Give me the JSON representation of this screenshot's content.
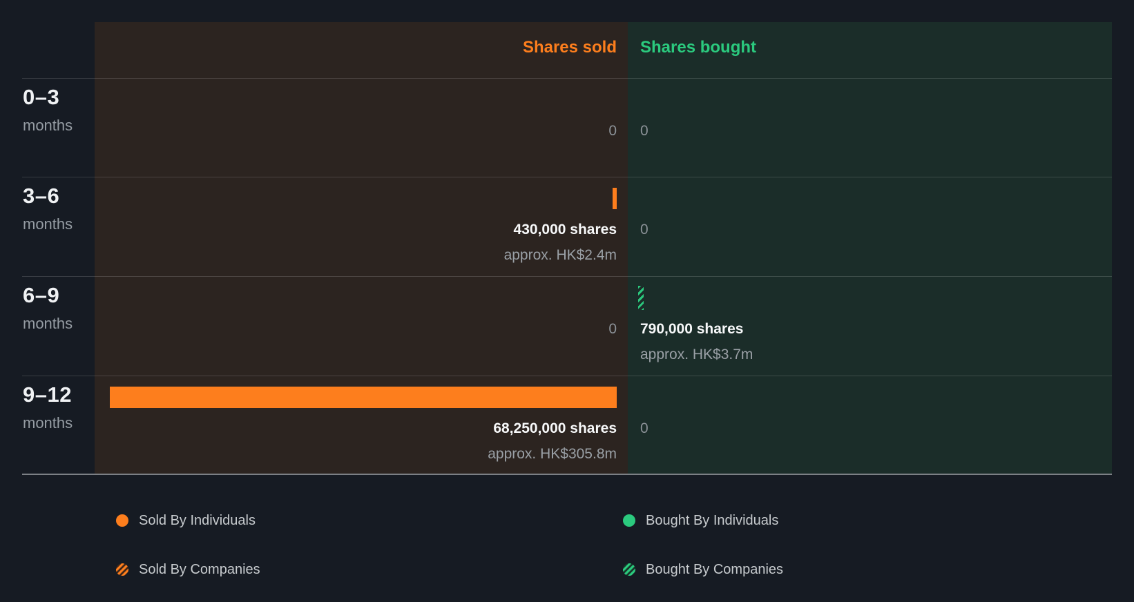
{
  "chart_data": {
    "type": "bar",
    "orientation": "horizontal",
    "unit": "shares",
    "currency": "HK$",
    "xmax": 68250000,
    "grid": "horizontal-row-dividers",
    "columns": [
      {
        "key": "sold",
        "header": "Shares sold",
        "color": "#fd7e1d"
      },
      {
        "key": "bought",
        "header": "Shares bought",
        "color": "#2bca7e"
      }
    ],
    "categories": [
      "0–3 months",
      "3–6 months",
      "6–9 months",
      "9–12 months"
    ],
    "series": [
      {
        "name": "Shares sold",
        "values": [
          0,
          430000,
          0,
          68250000
        ]
      },
      {
        "name": "Shares bought",
        "values": [
          0,
          0,
          790000,
          0
        ]
      }
    ],
    "rows": [
      {
        "period": "0–3",
        "period_unit": "months",
        "sold": {
          "value": 0,
          "label": "0",
          "approx": "",
          "hatched": false
        },
        "bought": {
          "value": 0,
          "label": "0",
          "approx": "",
          "hatched": false
        }
      },
      {
        "period": "3–6",
        "period_unit": "months",
        "sold": {
          "value": 430000,
          "label": "430,000 shares",
          "approx": "approx. HK$2.4m",
          "hatched": false
        },
        "bought": {
          "value": 0,
          "label": "0",
          "approx": "",
          "hatched": false
        }
      },
      {
        "period": "6–9",
        "period_unit": "months",
        "sold": {
          "value": 0,
          "label": "0",
          "approx": "",
          "hatched": false
        },
        "bought": {
          "value": 790000,
          "label": "790,000 shares",
          "approx": "approx. HK$3.7m",
          "hatched": true
        }
      },
      {
        "period": "9–12",
        "period_unit": "months",
        "sold": {
          "value": 68250000,
          "label": "68,250,000 shares",
          "approx": "approx. HK$305.8m",
          "hatched": false
        },
        "bought": {
          "value": 0,
          "label": "0",
          "approx": "",
          "hatched": false
        }
      }
    ],
    "legend": [
      {
        "label": "Sold By Individuals",
        "swatch": "sold-solid"
      },
      {
        "label": "Sold By Companies",
        "swatch": "sold-hatched"
      },
      {
        "label": "Bought By Individuals",
        "swatch": "bought-solid"
      },
      {
        "label": "Bought By Companies",
        "swatch": "bought-hatched"
      }
    ],
    "colors": {
      "background": "#161b23",
      "sold_accent": "#fd7e1d",
      "bought_accent": "#2bca7e",
      "sold_column_bg": "#2c2420",
      "bought_column_bg": "#1b2d29",
      "muted_text": "#9aa0a6",
      "legend_text": "#c7cbce"
    }
  }
}
